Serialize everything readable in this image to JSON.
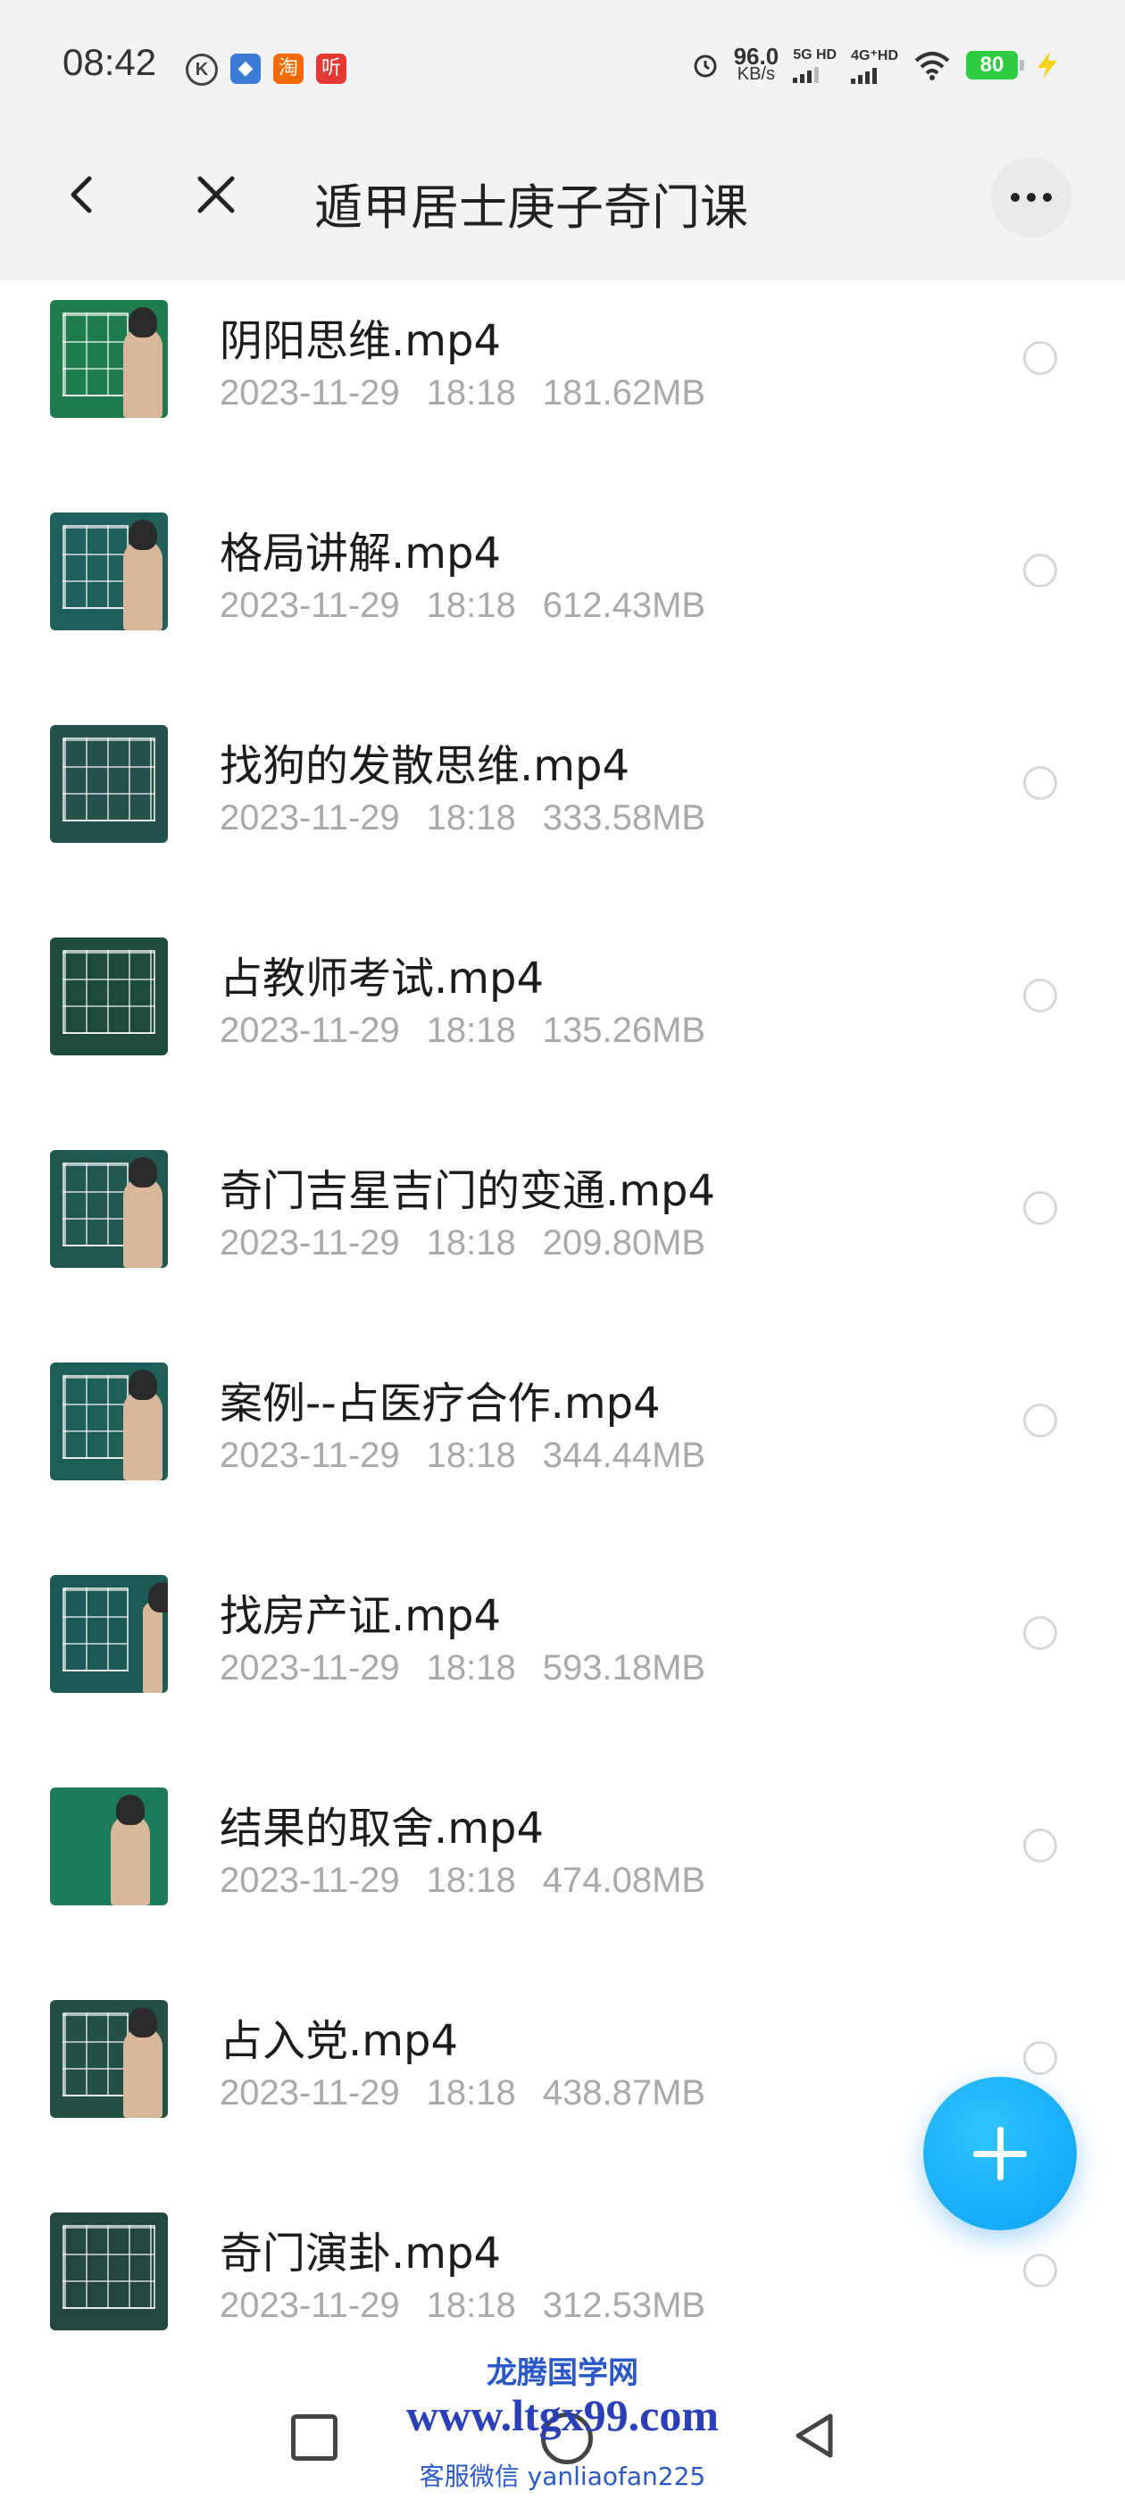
{
  "status_bar": {
    "time": "08:42",
    "k_badge": "K",
    "app_badges": [
      {
        "glyph": "◆",
        "color": "#3a7bd5"
      },
      {
        "glyph": "淘",
        "color": "#ff6a00"
      },
      {
        "glyph": "听",
        "color": "#e53935"
      }
    ],
    "speed_value": "96.0",
    "speed_unit": "KB/s",
    "net1": "5G HD",
    "net2": "4G⁺HD",
    "battery": "80",
    "icons": [
      "alarm-icon",
      "wifi-icon",
      "charging-icon"
    ]
  },
  "header": {
    "title": "遁甲居士庚子奇门课",
    "back_icon": "chevron-left-icon",
    "close_icon": "close-icon",
    "more_icon": "more-icon"
  },
  "files": [
    {
      "name": "阴阳思维.mp4",
      "date": "2023-11-29",
      "time": "18:18",
      "size": "181.62MB"
    },
    {
      "name": "格局讲解.mp4",
      "date": "2023-11-29",
      "time": "18:18",
      "size": "612.43MB"
    },
    {
      "name": "找狗的发散思维.mp4",
      "date": "2023-11-29",
      "time": "18:18",
      "size": "333.58MB"
    },
    {
      "name": "占教师考试.mp4",
      "date": "2023-11-29",
      "time": "18:18",
      "size": "135.26MB"
    },
    {
      "name": "奇门吉星吉门的变通.mp4",
      "date": "2023-11-29",
      "time": "18:18",
      "size": "209.80MB"
    },
    {
      "name": "案例--占医疗合作.mp4",
      "date": "2023-11-29",
      "time": "18:18",
      "size": "344.44MB"
    },
    {
      "name": "找房产证.mp4",
      "date": "2023-11-29",
      "time": "18:18",
      "size": "593.18MB"
    },
    {
      "name": "结果的取舍.mp4",
      "date": "2023-11-29",
      "time": "18:18",
      "size": "474.08MB"
    },
    {
      "name": "占入党.mp4",
      "date": "2023-11-29",
      "time": "18:18",
      "size": "438.87MB"
    },
    {
      "name": "奇门演卦.mp4",
      "date": "2023-11-29",
      "time": "18:18",
      "size": "312.53MB"
    }
  ],
  "fab": {
    "icon": "plus-icon",
    "color": "#0ea1f3"
  },
  "watermark": {
    "title": "龙腾国学网",
    "url": "www.ltgx99.com",
    "contact": "客服微信 yanliaofan225"
  },
  "nav": {
    "icons": [
      "recents-square-icon",
      "home-circle-icon",
      "back-triangle-icon"
    ]
  }
}
